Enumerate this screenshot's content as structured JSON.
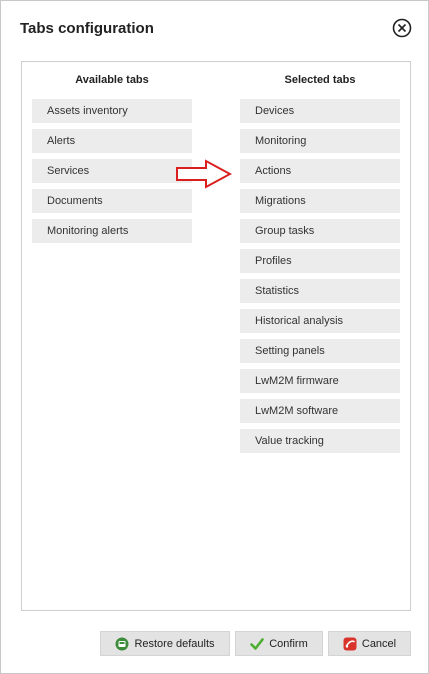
{
  "dialog": {
    "title": "Tabs configuration",
    "close_icon": "close-circle-icon"
  },
  "available": {
    "header": "Available tabs",
    "items": [
      "Assets inventory",
      "Alerts",
      "Services",
      "Documents",
      "Monitoring alerts"
    ]
  },
  "selected": {
    "header": "Selected tabs",
    "items": [
      "Devices",
      "Monitoring",
      "Actions",
      "Migrations",
      "Group tasks",
      "Profiles",
      "Statistics",
      "Historical analysis",
      "Setting panels",
      "LwM2M firmware",
      "LwM2M software",
      "Value tracking"
    ]
  },
  "arrow": {
    "icon": "right-arrow-icon",
    "color": "#d9201f"
  },
  "footer": {
    "restore_label": "Restore defaults",
    "confirm_label": "Confirm",
    "cancel_label": "Cancel"
  },
  "colors": {
    "item_bg": "#ececec",
    "button_bg": "#e3e3e3",
    "confirm_icon": "#4caf2f",
    "cancel_icon": "#d9342b",
    "restore_icon": "#3c8c3c"
  }
}
